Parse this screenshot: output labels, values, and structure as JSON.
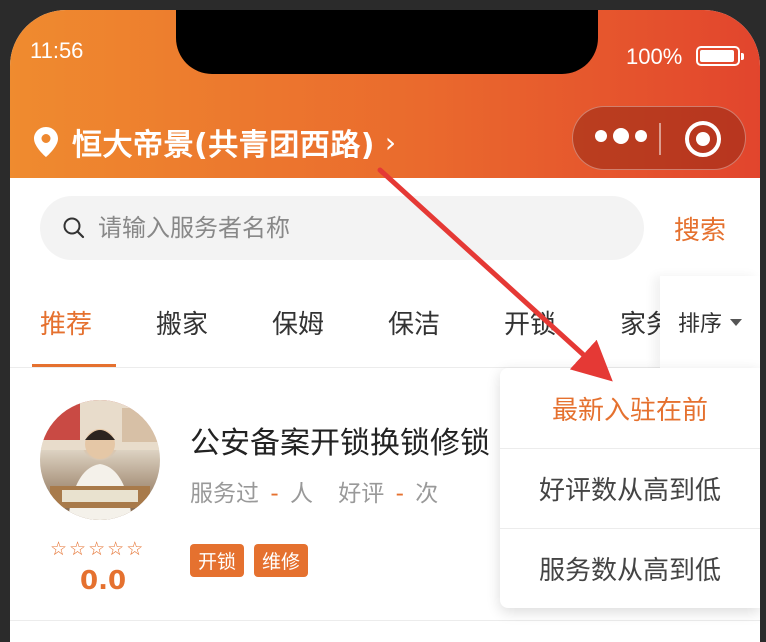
{
  "status_bar": {
    "time": "11:56",
    "battery_percent": "100%"
  },
  "header": {
    "location": "恒大帝景(共青团西路)",
    "location_chevron": "›",
    "pin_icon": "location-pin-icon",
    "more_icon": "more-dots-icon",
    "close_icon": "target-circle-icon"
  },
  "search": {
    "placeholder": "请输入服务者名称",
    "button_label": "搜索"
  },
  "tabs": [
    {
      "label": "推荐",
      "active": true
    },
    {
      "label": "搬家",
      "active": false
    },
    {
      "label": "保姆",
      "active": false
    },
    {
      "label": "保洁",
      "active": false
    },
    {
      "label": "开锁",
      "active": false
    },
    {
      "label": "家务",
      "active": false
    }
  ],
  "sort": {
    "label": "排序",
    "options": [
      {
        "label": "最新入驻在前",
        "active": true
      },
      {
        "label": "好评数从高到低",
        "active": false
      },
      {
        "label": "服务数从高到低",
        "active": false
      }
    ]
  },
  "provider": {
    "name": "公安备案开锁换锁修锁",
    "served_prefix": "服务过",
    "served_value": "-",
    "served_unit": "人",
    "reviews_prefix": "好评",
    "reviews_value": "-",
    "reviews_unit": "次",
    "stars": "☆☆☆☆☆",
    "rating": "0.0",
    "tags": [
      "开锁",
      "维修"
    ]
  },
  "colors": {
    "accent": "#e5712f",
    "header_start": "#ef8b2f",
    "header_end": "#e2452d",
    "annotation_arrow": "#e53935"
  }
}
